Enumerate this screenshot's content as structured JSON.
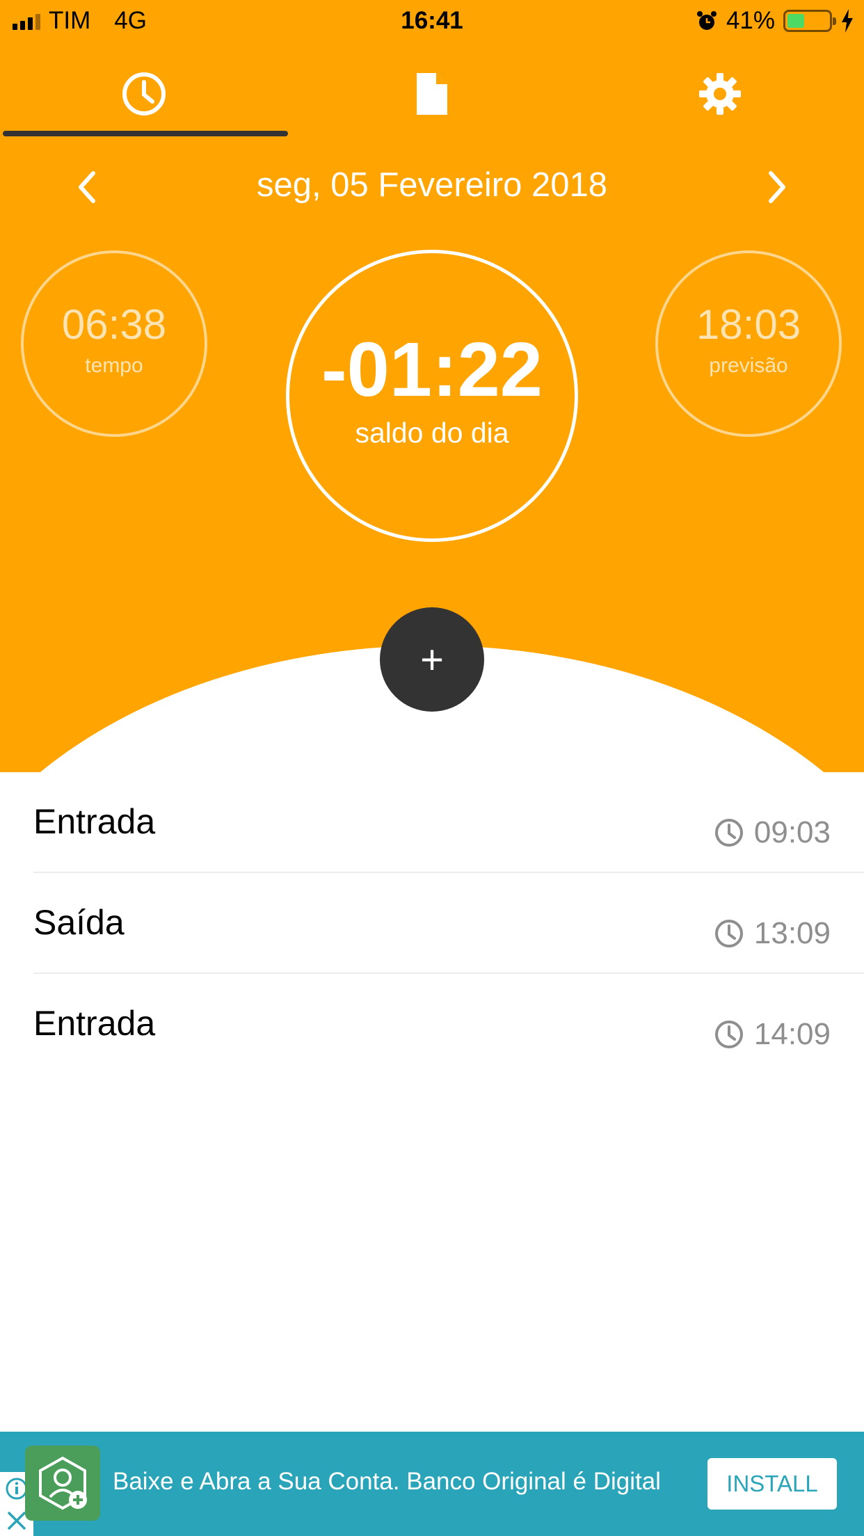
{
  "status_bar": {
    "carrier": "TIM",
    "network": "4G",
    "time": "16:41",
    "battery": "41%",
    "battery_level": 0.41
  },
  "tabs": [
    {
      "icon": "clock-icon",
      "active": true
    },
    {
      "icon": "document-icon",
      "active": false
    },
    {
      "icon": "gear-icon",
      "active": false
    }
  ],
  "date_nav": {
    "date": "seg, 05 Fevereiro 2018"
  },
  "summary": {
    "tempo": {
      "value": "06:38",
      "label": "tempo"
    },
    "saldo": {
      "value": "-01:22",
      "label": "saldo do dia"
    },
    "previsao": {
      "value": "18:03",
      "label": "previsão"
    }
  },
  "fab": {
    "label": "+"
  },
  "entries": [
    {
      "label": "Entrada",
      "time": "09:03"
    },
    {
      "label": "Saída",
      "time": "13:09"
    },
    {
      "label": "Entrada",
      "time": "14:09"
    }
  ],
  "ad": {
    "text": "Baixe e Abra a Sua Conta. Banco Original é Digital",
    "install_label": "INSTALL"
  },
  "colors": {
    "primary": "#ffa400",
    "fab": "#333333",
    "ad": "#2aa4b8"
  }
}
